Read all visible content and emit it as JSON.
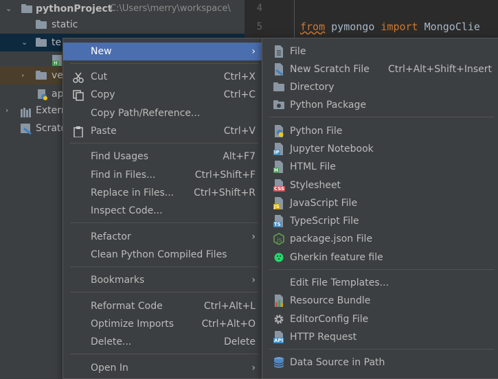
{
  "project_tree": {
    "root_name": "pythonProject",
    "root_path": "C:\\Users\\merry\\workspace\\",
    "items": [
      {
        "label": "static"
      },
      {
        "label": "te"
      },
      {
        "label": "ve"
      },
      {
        "label": "ap"
      },
      {
        "label": "Extern"
      },
      {
        "label": "Scrato"
      }
    ]
  },
  "editor": {
    "line_numbers": [
      "4",
      "5"
    ],
    "code_line": {
      "kw1": "from",
      "module": "pymongo",
      "kw2": "import",
      "name": "MongoClie"
    }
  },
  "context_menu": {
    "new": "New",
    "cut": {
      "label": "Cut",
      "shortcut": "Ctrl+X"
    },
    "copy": {
      "label": "Copy",
      "shortcut": "Ctrl+C"
    },
    "copy_path": {
      "label": "Copy Path/Reference..."
    },
    "paste": {
      "label": "Paste",
      "shortcut": "Ctrl+V"
    },
    "find_usages": {
      "label": "Find Usages",
      "shortcut": "Alt+F7"
    },
    "find_in_files": {
      "label": "Find in Files...",
      "shortcut": "Ctrl+Shift+F"
    },
    "replace_in_files": {
      "label": "Replace in Files...",
      "shortcut": "Ctrl+Shift+R"
    },
    "inspect_code": {
      "label": "Inspect Code..."
    },
    "refactor": {
      "label": "Refactor"
    },
    "clean_python": {
      "label": "Clean Python Compiled Files"
    },
    "bookmarks": {
      "label": "Bookmarks"
    },
    "reformat": {
      "label": "Reformat Code",
      "shortcut": "Ctrl+Alt+L"
    },
    "optimize": {
      "label": "Optimize Imports",
      "shortcut": "Ctrl+Alt+O"
    },
    "delete": {
      "label": "Delete...",
      "shortcut": "Delete"
    },
    "open_in": {
      "label": "Open In"
    }
  },
  "new_submenu": {
    "file": "File",
    "scratch": {
      "label": "New Scratch File",
      "shortcut": "Ctrl+Alt+Shift+Insert"
    },
    "directory": "Directory",
    "python_package": "Python Package",
    "python_file": "Python File",
    "jupyter": "Jupyter Notebook",
    "html": "HTML File",
    "stylesheet": "Stylesheet",
    "javascript": "JavaScript File",
    "typescript": "TypeScript File",
    "package_json": "package.json File",
    "gherkin": "Gherkin feature file",
    "templates": "Edit File Templates...",
    "resource_bundle": "Resource Bundle",
    "editorconfig": "EditorConfig File",
    "http_request": "HTTP Request",
    "datasource": "Data Source in Path"
  },
  "badges": {
    "jupyter": "IP",
    "html": "H",
    "css": "CSS",
    "js": "JS",
    "ts": "TS",
    "api": "API"
  },
  "colors": {
    "menu_bg": "#3c3f41",
    "selection": "#4b6eaf",
    "editor_bg": "#2b2b2b",
    "keyword": "#cc7832"
  }
}
